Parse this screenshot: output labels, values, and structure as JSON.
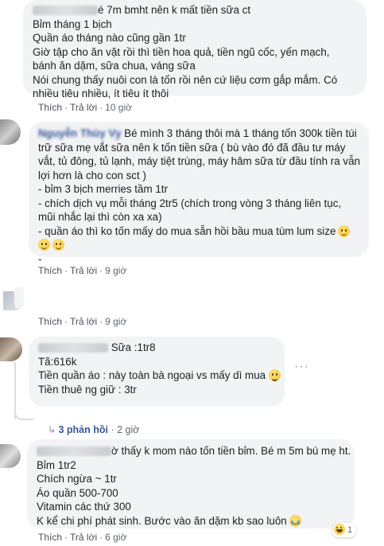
{
  "comments": [
    {
      "first_line_visible": "é 7m bmht nên k mất tiền sữa ct",
      "lines": [
        "Bỉm tháng 1 bịch",
        "Quần áo tháng nào cũng gần 1tr",
        "Giờ tập cho ăn vặt rồi thì tiền hoa quả, tiền ngũ cốc, yến mạch,",
        "bánh ăn dặm, sữa chua, váng sữa",
        "Nói chung thấy nuôi con là tốn rồi nên cứ liệu cơm gắp mắm. Có",
        "nhiều tiêu nhiều, ít tiêu ít thôi"
      ],
      "like": "Thích",
      "reply": "Trả lời",
      "time": "10 giờ"
    },
    {
      "name": "Nguyễn Thùy Vy",
      "first_line": "Bé mình 3 tháng thôi mà 1 tháng tốn 300k tiền túi",
      "lines": [
        "trữ sữa mẹ vắt sữa nên k tốn tiền sữa ( bù vào đó đã đầu tư máy",
        "vắt, tủ đông, tủ lạnh, máy tiệt trùng, máy hâm sữa từ đầu tính ra vẫn",
        "lợi hơn là cho con sct )",
        "- bỉm 3 bịch merries tầm 1tr",
        "- chích dịch vụ mỗi tháng 2tr5 (chích trong vòng 3 tháng liên tục,",
        "mũi nhắc lại thì còn xa xa)",
        "- quần áo thì ko tốn mấy do mua sẵn hồi bầu mua tùm lum size"
      ],
      "last_line": "-",
      "like": "Thích",
      "reply": "Trả lời",
      "time": "9 giờ"
    },
    {
      "like": "Thích",
      "reply": "Trả lời",
      "time": "9 giờ"
    },
    {
      "first_line_visible": "Sữa :1tr8",
      "lines": [
        "Tã:616k",
        "Tiền quần áo : này toàn bà ngoại vs mấy dì mua",
        "Tiền thuê ng giữ : 3tr"
      ],
      "replies_link": "3 phản hồi",
      "time": "2 giờ"
    },
    {
      "first_line_visible": "ờ thấy k mom nào tốn tiền bỉm. Bé m 5m bú mẹ ht.",
      "lines": [
        "Bỉm 1tr2",
        "Chích ngừa ~ 1tr",
        "Áo quần 500-700",
        "Vitamin các thứ 300",
        "K kể chi phí phát sinh. Bước vào ăn dặm kb sao luôn"
      ],
      "reaction_count": "1",
      "like": "Thích",
      "reply": "Trả lời",
      "time": "6 giờ"
    }
  ],
  "icons": {
    "more": "more-dots-icon",
    "smile": "slightly-smiling-emoji",
    "grin": "grinning-emoji",
    "cry": "loudly-crying-emoji",
    "haha": "haha-reaction-icon"
  },
  "colors": {
    "bubble": "#f2f3f5",
    "link": "#385898",
    "meta": "#606770"
  }
}
